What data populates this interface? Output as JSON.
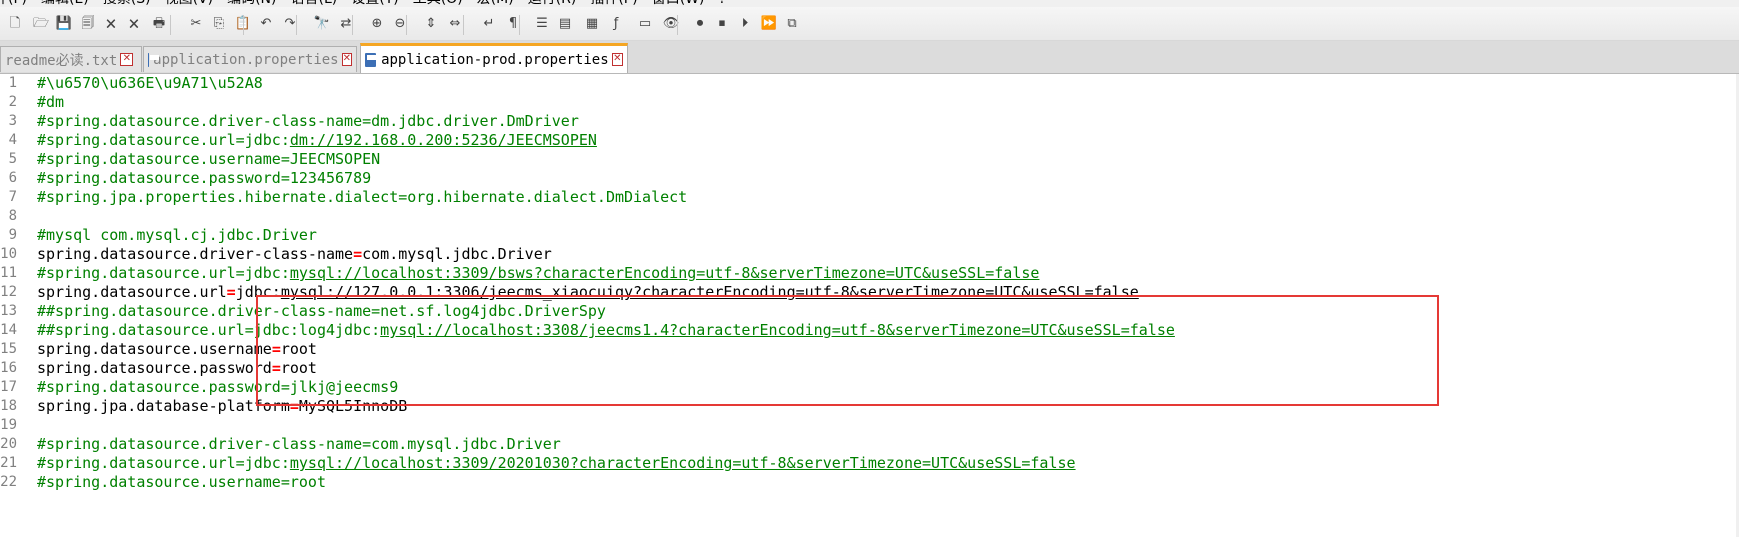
{
  "menu": [
    "件(F)",
    "编辑(E)",
    "搜索(S)",
    "视图(V)",
    "编码(N)",
    "语言(L)",
    "设置(T)",
    "工具(O)",
    "宏(M)",
    "运行(R)",
    "插件(P)",
    "窗口(W)",
    "?"
  ],
  "toolbar": [
    {
      "name": "new-file-icon",
      "glyph": "🗋"
    },
    {
      "name": "open-file-icon",
      "glyph": "🗁"
    },
    {
      "name": "save-icon",
      "glyph": "💾"
    },
    {
      "name": "save-all-icon",
      "glyph": "🗐"
    },
    {
      "name": "close-icon",
      "glyph": "🗙"
    },
    {
      "name": "close-all-icon",
      "glyph": "🗙"
    },
    {
      "name": "print-icon",
      "glyph": "🖶"
    },
    {
      "name": "cut-icon",
      "glyph": "✂"
    },
    {
      "name": "copy-icon",
      "glyph": "⎘"
    },
    {
      "name": "paste-icon",
      "glyph": "📋"
    },
    {
      "name": "undo-icon",
      "glyph": "↶"
    },
    {
      "name": "redo-icon",
      "glyph": "↷"
    },
    {
      "name": "find-icon",
      "glyph": "🔭"
    },
    {
      "name": "replace-icon",
      "glyph": "⇄"
    },
    {
      "name": "zoom-in-icon",
      "glyph": "⊕"
    },
    {
      "name": "zoom-out-icon",
      "glyph": "⊖"
    },
    {
      "name": "sync-vertical-icon",
      "glyph": "⇕"
    },
    {
      "name": "sync-horizontal-icon",
      "glyph": "⇔"
    },
    {
      "name": "word-wrap-icon",
      "glyph": "↵"
    },
    {
      "name": "show-all-chars-icon",
      "glyph": "¶"
    },
    {
      "name": "indent-guide-icon",
      "glyph": "☰"
    },
    {
      "name": "user-language-icon",
      "glyph": "▤"
    },
    {
      "name": "document-map-icon",
      "glyph": "▦"
    },
    {
      "name": "function-list-icon",
      "glyph": "ƒ"
    },
    {
      "name": "folder-as-workspace-icon",
      "glyph": "▭"
    },
    {
      "name": "monitoring-icon",
      "glyph": "👁"
    },
    {
      "name": "record-macro-icon",
      "glyph": "⏺"
    },
    {
      "name": "stop-recording-icon",
      "glyph": "⏹"
    },
    {
      "name": "playback-macro-icon",
      "glyph": "⏵"
    },
    {
      "name": "run-macro-multiple-icon",
      "glyph": "⏩"
    },
    {
      "name": "save-macro-icon",
      "glyph": "⧉"
    }
  ],
  "tabs": [
    {
      "label": "readme必读.txt",
      "active": false
    },
    {
      "label": "application.properties",
      "active": false
    },
    {
      "label": "application-prod.properties",
      "active": true
    }
  ],
  "editor": {
    "lines": [
      {
        "n": "1",
        "segs": [
          {
            "t": "#\\u6570\\u636E\\u9A71\\u52A8",
            "k": "c"
          }
        ]
      },
      {
        "n": "2",
        "segs": [
          {
            "t": "#dm",
            "k": "c"
          }
        ]
      },
      {
        "n": "3",
        "segs": [
          {
            "t": "#spring.datasource.driver-class-name=dm.jdbc.driver.DmDriver",
            "k": "c"
          }
        ]
      },
      {
        "n": "4",
        "segs": [
          {
            "t": "#spring.datasource.url=jdbc:",
            "k": "c"
          },
          {
            "t": "dm://192.168.0.200:5236/JEECMSOPEN",
            "k": "cu"
          }
        ]
      },
      {
        "n": "5",
        "segs": [
          {
            "t": "#spring.datasource.username=JEECMSOPEN",
            "k": "c"
          }
        ]
      },
      {
        "n": "6",
        "segs": [
          {
            "t": "#spring.datasource.password=123456789",
            "k": "c"
          }
        ]
      },
      {
        "n": "7",
        "segs": [
          {
            "t": "#spring.jpa.properties.hibernate.dialect=org.hibernate.dialect.DmDialect",
            "k": "c"
          }
        ]
      },
      {
        "n": "8",
        "segs": []
      },
      {
        "n": "9",
        "segs": [
          {
            "t": "#mysql com.mysql.cj.jdbc.Driver",
            "k": "c"
          }
        ]
      },
      {
        "n": "10",
        "segs": [
          {
            "t": "spring.datasource.driver-class-name",
            "k": ""
          },
          {
            "t": "=",
            "k": "eq"
          },
          {
            "t": "com.mysql.jdbc.Driver",
            "k": ""
          }
        ]
      },
      {
        "n": "11",
        "segs": [
          {
            "t": "#spring.datasource.url=jdbc:",
            "k": "c"
          },
          {
            "t": "mysql://localhost:3309/bsws?characterEncoding=utf-8&serverTimezone=UTC&useSSL=false",
            "k": "cu"
          }
        ]
      },
      {
        "n": "12",
        "segs": [
          {
            "t": "spring.datasource.url",
            "k": ""
          },
          {
            "t": "=",
            "k": "eq"
          },
          {
            "t": "jdbc:",
            "k": ""
          },
          {
            "t": "mysql://127.0.0.1:3306/jeecms_xiaocuiqy?characterEncoding=utf-8&serverTimezone=UTC&useSSL=false",
            "k": "u"
          }
        ]
      },
      {
        "n": "13",
        "segs": [
          {
            "t": "##spring.datasource.driver-class-name=net.sf.log4jdbc.DriverSpy",
            "k": "c"
          }
        ]
      },
      {
        "n": "14",
        "segs": [
          {
            "t": "##spring.datasource.url=jdbc:log4jdbc:",
            "k": "c"
          },
          {
            "t": "mysql://localhost:3308/jeecms1.4?characterEncoding=utf-8&serverTimezone=UTC&useSSL=false",
            "k": "cu"
          }
        ]
      },
      {
        "n": "15",
        "segs": [
          {
            "t": "spring.datasource.username",
            "k": ""
          },
          {
            "t": "=",
            "k": "eq"
          },
          {
            "t": "root",
            "k": ""
          }
        ]
      },
      {
        "n": "16",
        "segs": [
          {
            "t": "spring.datasource.password",
            "k": ""
          },
          {
            "t": "=",
            "k": "eq"
          },
          {
            "t": "root",
            "k": ""
          }
        ]
      },
      {
        "n": "17",
        "segs": [
          {
            "t": "#spring.datasource.password=jlkj@jeecms9",
            "k": "c"
          }
        ]
      },
      {
        "n": "18",
        "segs": [
          {
            "t": "spring.jpa.database-platform",
            "k": ""
          },
          {
            "t": "=",
            "k": "eq"
          },
          {
            "t": "MySQL5InnoDB",
            "k": ""
          }
        ]
      },
      {
        "n": "19",
        "segs": []
      },
      {
        "n": "20",
        "segs": [
          {
            "t": "#spring.datasource.driver-class-name=com.mysql.jdbc.Driver",
            "k": "c"
          }
        ]
      },
      {
        "n": "21",
        "segs": [
          {
            "t": "#spring.datasource.url=jdbc:",
            "k": "c"
          },
          {
            "t": "mysql://localhost:3309/20201030?characterEncoding=utf-8&serverTimezone=UTC&useSSL=false",
            "k": "cu"
          }
        ]
      },
      {
        "n": "22",
        "segs": [
          {
            "t": "#spring.datasource.username=root",
            "k": "c"
          }
        ]
      }
    ]
  }
}
